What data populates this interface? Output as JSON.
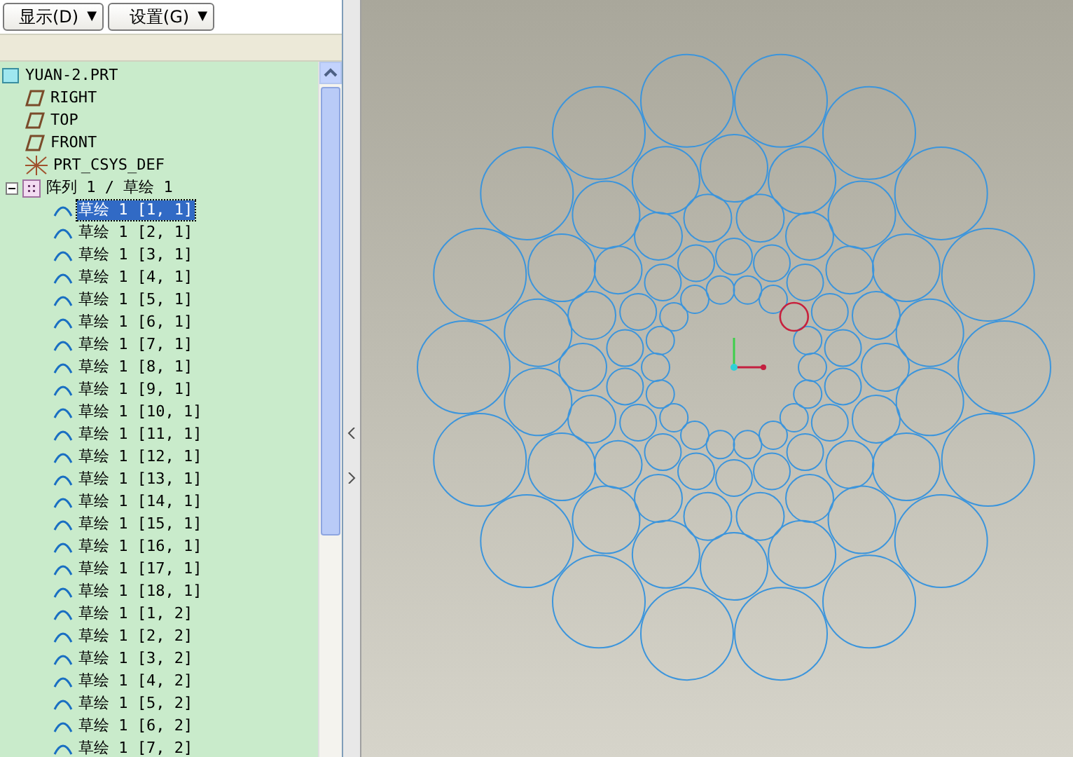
{
  "toolbar": {
    "buttons": [
      {
        "label": "显示(D)",
        "caret": "▼"
      },
      {
        "label": "设置(G)",
        "caret": "▼"
      }
    ]
  },
  "model_tree": {
    "items": [
      {
        "kind": "part",
        "label": "YUAN-2.PRT",
        "selected": false,
        "children": [
          {
            "kind": "plane",
            "label": "RIGHT",
            "selected": false
          },
          {
            "kind": "plane",
            "label": "TOP",
            "selected": false
          },
          {
            "kind": "plane",
            "label": "FRONT",
            "selected": false
          },
          {
            "kind": "csys",
            "label": "PRT_CSYS_DEF",
            "selected": false
          },
          {
            "kind": "pattern",
            "label": "阵列 1 / 草绘 1",
            "selected": false,
            "expanded": true,
            "children": [
              {
                "kind": "sketch",
                "label": "草绘 1 [1, 1]",
                "selected": true
              },
              {
                "kind": "sketch",
                "label": "草绘 1 [2, 1]",
                "selected": false
              },
              {
                "kind": "sketch",
                "label": "草绘 1 [3, 1]",
                "selected": false
              },
              {
                "kind": "sketch",
                "label": "草绘 1 [4, 1]",
                "selected": false
              },
              {
                "kind": "sketch",
                "label": "草绘 1 [5, 1]",
                "selected": false
              },
              {
                "kind": "sketch",
                "label": "草绘 1 [6, 1]",
                "selected": false
              },
              {
                "kind": "sketch",
                "label": "草绘 1 [7, 1]",
                "selected": false
              },
              {
                "kind": "sketch",
                "label": "草绘 1 [8, 1]",
                "selected": false
              },
              {
                "kind": "sketch",
                "label": "草绘 1 [9, 1]",
                "selected": false
              },
              {
                "kind": "sketch",
                "label": "草绘 1 [10, 1]",
                "selected": false
              },
              {
                "kind": "sketch",
                "label": "草绘 1 [11, 1]",
                "selected": false
              },
              {
                "kind": "sketch",
                "label": "草绘 1 [12, 1]",
                "selected": false
              },
              {
                "kind": "sketch",
                "label": "草绘 1 [13, 1]",
                "selected": false
              },
              {
                "kind": "sketch",
                "label": "草绘 1 [14, 1]",
                "selected": false
              },
              {
                "kind": "sketch",
                "label": "草绘 1 [15, 1]",
                "selected": false
              },
              {
                "kind": "sketch",
                "label": "草绘 1 [16, 1]",
                "selected": false
              },
              {
                "kind": "sketch",
                "label": "草绘 1 [17, 1]",
                "selected": false
              },
              {
                "kind": "sketch",
                "label": "草绘 1 [18, 1]",
                "selected": false
              },
              {
                "kind": "sketch",
                "label": "草绘 1 [1, 2]",
                "selected": false
              },
              {
                "kind": "sketch",
                "label": "草绘 1 [2, 2]",
                "selected": false
              },
              {
                "kind": "sketch",
                "label": "草绘 1 [3, 2]",
                "selected": false
              },
              {
                "kind": "sketch",
                "label": "草绘 1 [4, 2]",
                "selected": false
              },
              {
                "kind": "sketch",
                "label": "草绘 1 [5, 2]",
                "selected": false
              },
              {
                "kind": "sketch",
                "label": "草绘 1 [6, 2]",
                "selected": false
              },
              {
                "kind": "sketch",
                "label": "草绘 1 [7, 2]",
                "selected": false
              }
            ]
          }
        ]
      }
    ]
  }
}
